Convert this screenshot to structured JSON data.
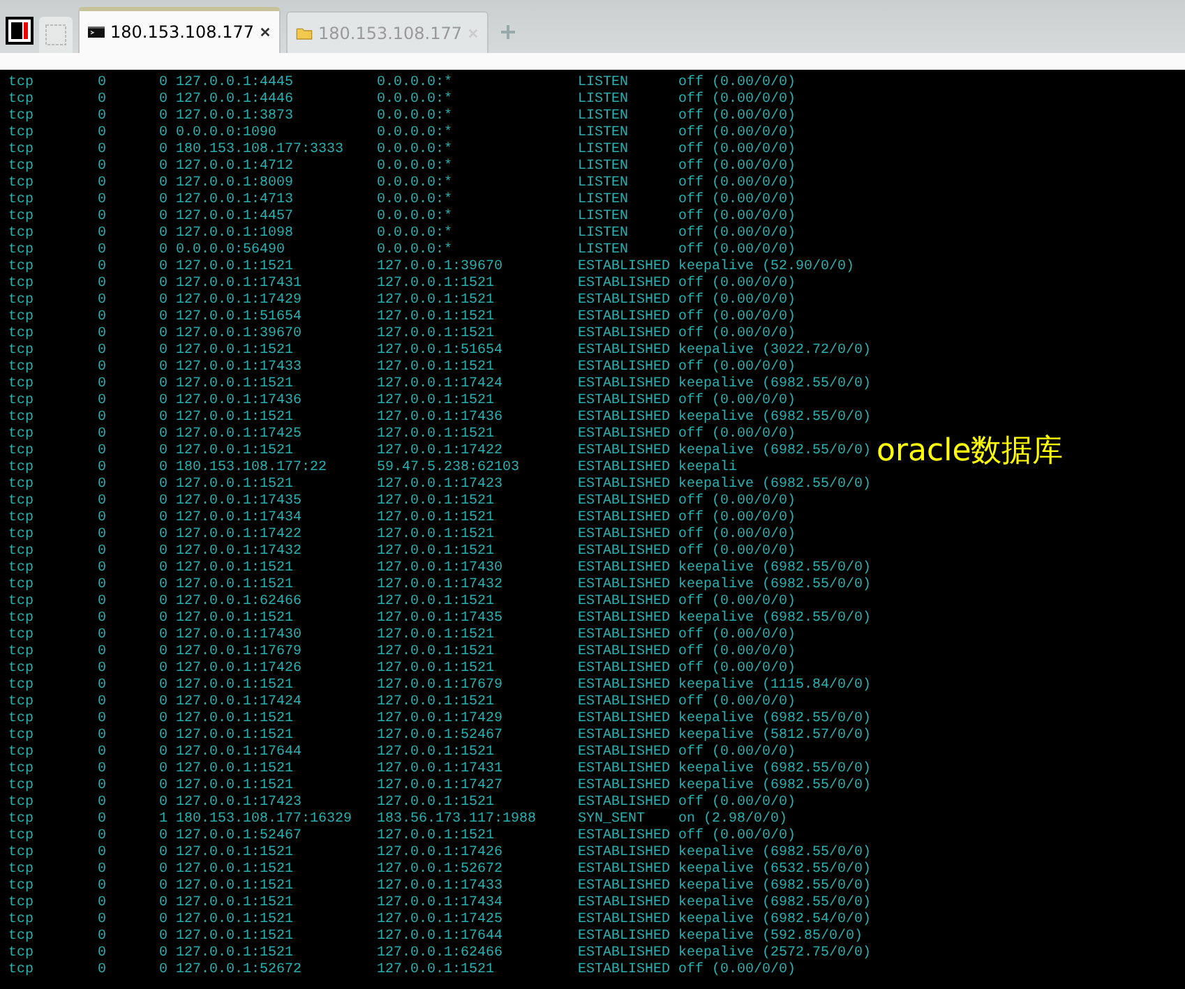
{
  "tabs": [
    {
      "kind": "terminal",
      "label": "180.153.108.177",
      "selected": true
    },
    {
      "kind": "folder",
      "label": "180.153.108.177",
      "selected": false
    }
  ],
  "terminal": {
    "rows": [
      {
        "proto": "tcp",
        "recv_q": "0",
        "send_q": "0",
        "local": "127.0.0.1:4445",
        "foreign": "0.0.0.0:*",
        "state": "LISTEN",
        "timer": "off (0.00/0/0)"
      },
      {
        "proto": "tcp",
        "recv_q": "0",
        "send_q": "0",
        "local": "127.0.0.1:4446",
        "foreign": "0.0.0.0:*",
        "state": "LISTEN",
        "timer": "off (0.00/0/0)"
      },
      {
        "proto": "tcp",
        "recv_q": "0",
        "send_q": "0",
        "local": "127.0.0.1:3873",
        "foreign": "0.0.0.0:*",
        "state": "LISTEN",
        "timer": "off (0.00/0/0)"
      },
      {
        "proto": "tcp",
        "recv_q": "0",
        "send_q": "0",
        "local": "0.0.0.0:1090",
        "foreign": "0.0.0.0:*",
        "state": "LISTEN",
        "timer": "off (0.00/0/0)"
      },
      {
        "proto": "tcp",
        "recv_q": "0",
        "send_q": "0",
        "local": "180.153.108.177:3333",
        "foreign": "0.0.0.0:*",
        "state": "LISTEN",
        "timer": "off (0.00/0/0)"
      },
      {
        "proto": "tcp",
        "recv_q": "0",
        "send_q": "0",
        "local": "127.0.0.1:4712",
        "foreign": "0.0.0.0:*",
        "state": "LISTEN",
        "timer": "off (0.00/0/0)"
      },
      {
        "proto": "tcp",
        "recv_q": "0",
        "send_q": "0",
        "local": "127.0.0.1:8009",
        "foreign": "0.0.0.0:*",
        "state": "LISTEN",
        "timer": "off (0.00/0/0)"
      },
      {
        "proto": "tcp",
        "recv_q": "0",
        "send_q": "0",
        "local": "127.0.0.1:4713",
        "foreign": "0.0.0.0:*",
        "state": "LISTEN",
        "timer": "off (0.00/0/0)"
      },
      {
        "proto": "tcp",
        "recv_q": "0",
        "send_q": "0",
        "local": "127.0.0.1:4457",
        "foreign": "0.0.0.0:*",
        "state": "LISTEN",
        "timer": "off (0.00/0/0)"
      },
      {
        "proto": "tcp",
        "recv_q": "0",
        "send_q": "0",
        "local": "127.0.0.1:1098",
        "foreign": "0.0.0.0:*",
        "state": "LISTEN",
        "timer": "off (0.00/0/0)"
      },
      {
        "proto": "tcp",
        "recv_q": "0",
        "send_q": "0",
        "local": "0.0.0.0:56490",
        "foreign": "0.0.0.0:*",
        "state": "LISTEN",
        "timer": "off (0.00/0/0)"
      },
      {
        "proto": "tcp",
        "recv_q": "0",
        "send_q": "0",
        "local": "127.0.0.1:1521",
        "foreign": "127.0.0.1:39670",
        "state": "ESTABLISHED",
        "timer": "keepalive (52.90/0/0)"
      },
      {
        "proto": "tcp",
        "recv_q": "0",
        "send_q": "0",
        "local": "127.0.0.1:17431",
        "foreign": "127.0.0.1:1521",
        "state": "ESTABLISHED",
        "timer": "off (0.00/0/0)"
      },
      {
        "proto": "tcp",
        "recv_q": "0",
        "send_q": "0",
        "local": "127.0.0.1:17429",
        "foreign": "127.0.0.1:1521",
        "state": "ESTABLISHED",
        "timer": "off (0.00/0/0)"
      },
      {
        "proto": "tcp",
        "recv_q": "0",
        "send_q": "0",
        "local": "127.0.0.1:51654",
        "foreign": "127.0.0.1:1521",
        "state": "ESTABLISHED",
        "timer": "off (0.00/0/0)"
      },
      {
        "proto": "tcp",
        "recv_q": "0",
        "send_q": "0",
        "local": "127.0.0.1:39670",
        "foreign": "127.0.0.1:1521",
        "state": "ESTABLISHED",
        "timer": "off (0.00/0/0)"
      },
      {
        "proto": "tcp",
        "recv_q": "0",
        "send_q": "0",
        "local": "127.0.0.1:1521",
        "foreign": "127.0.0.1:51654",
        "state": "ESTABLISHED",
        "timer": "keepalive (3022.72/0/0)"
      },
      {
        "proto": "tcp",
        "recv_q": "0",
        "send_q": "0",
        "local": "127.0.0.1:17433",
        "foreign": "127.0.0.1:1521",
        "state": "ESTABLISHED",
        "timer": "off (0.00/0/0)"
      },
      {
        "proto": "tcp",
        "recv_q": "0",
        "send_q": "0",
        "local": "127.0.0.1:1521",
        "foreign": "127.0.0.1:17424",
        "state": "ESTABLISHED",
        "timer": "keepalive (6982.55/0/0)"
      },
      {
        "proto": "tcp",
        "recv_q": "0",
        "send_q": "0",
        "local": "127.0.0.1:17436",
        "foreign": "127.0.0.1:1521",
        "state": "ESTABLISHED",
        "timer": "off (0.00/0/0)"
      },
      {
        "proto": "tcp",
        "recv_q": "0",
        "send_q": "0",
        "local": "127.0.0.1:1521",
        "foreign": "127.0.0.1:17436",
        "state": "ESTABLISHED",
        "timer": "keepalive (6982.55/0/0)"
      },
      {
        "proto": "tcp",
        "recv_q": "0",
        "send_q": "0",
        "local": "127.0.0.1:17425",
        "foreign": "127.0.0.1:1521",
        "state": "ESTABLISHED",
        "timer": "off (0.00/0/0)"
      },
      {
        "proto": "tcp",
        "recv_q": "0",
        "send_q": "0",
        "local": "127.0.0.1:1521",
        "foreign": "127.0.0.1:17422",
        "state": "ESTABLISHED",
        "timer": "keepalive (6982.55/0/0)"
      },
      {
        "proto": "tcp",
        "recv_q": "0",
        "send_q": "0",
        "local": "180.153.108.177:22",
        "foreign": "59.47.5.238:62103",
        "state": "ESTABLISHED",
        "timer": "keepali"
      },
      {
        "proto": "tcp",
        "recv_q": "0",
        "send_q": "0",
        "local": "127.0.0.1:1521",
        "foreign": "127.0.0.1:17423",
        "state": "ESTABLISHED",
        "timer": "keepalive (6982.55/0/0)"
      },
      {
        "proto": "tcp",
        "recv_q": "0",
        "send_q": "0",
        "local": "127.0.0.1:17435",
        "foreign": "127.0.0.1:1521",
        "state": "ESTABLISHED",
        "timer": "off (0.00/0/0)"
      },
      {
        "proto": "tcp",
        "recv_q": "0",
        "send_q": "0",
        "local": "127.0.0.1:17434",
        "foreign": "127.0.0.1:1521",
        "state": "ESTABLISHED",
        "timer": "off (0.00/0/0)"
      },
      {
        "proto": "tcp",
        "recv_q": "0",
        "send_q": "0",
        "local": "127.0.0.1:17422",
        "foreign": "127.0.0.1:1521",
        "state": "ESTABLISHED",
        "timer": "off (0.00/0/0)"
      },
      {
        "proto": "tcp",
        "recv_q": "0",
        "send_q": "0",
        "local": "127.0.0.1:17432",
        "foreign": "127.0.0.1:1521",
        "state": "ESTABLISHED",
        "timer": "off (0.00/0/0)"
      },
      {
        "proto": "tcp",
        "recv_q": "0",
        "send_q": "0",
        "local": "127.0.0.1:1521",
        "foreign": "127.0.0.1:17430",
        "state": "ESTABLISHED",
        "timer": "keepalive (6982.55/0/0)"
      },
      {
        "proto": "tcp",
        "recv_q": "0",
        "send_q": "0",
        "local": "127.0.0.1:1521",
        "foreign": "127.0.0.1:17432",
        "state": "ESTABLISHED",
        "timer": "keepalive (6982.55/0/0)"
      },
      {
        "proto": "tcp",
        "recv_q": "0",
        "send_q": "0",
        "local": "127.0.0.1:62466",
        "foreign": "127.0.0.1:1521",
        "state": "ESTABLISHED",
        "timer": "off (0.00/0/0)"
      },
      {
        "proto": "tcp",
        "recv_q": "0",
        "send_q": "0",
        "local": "127.0.0.1:1521",
        "foreign": "127.0.0.1:17435",
        "state": "ESTABLISHED",
        "timer": "keepalive (6982.55/0/0)"
      },
      {
        "proto": "tcp",
        "recv_q": "0",
        "send_q": "0",
        "local": "127.0.0.1:17430",
        "foreign": "127.0.0.1:1521",
        "state": "ESTABLISHED",
        "timer": "off (0.00/0/0)"
      },
      {
        "proto": "tcp",
        "recv_q": "0",
        "send_q": "0",
        "local": "127.0.0.1:17679",
        "foreign": "127.0.0.1:1521",
        "state": "ESTABLISHED",
        "timer": "off (0.00/0/0)"
      },
      {
        "proto": "tcp",
        "recv_q": "0",
        "send_q": "0",
        "local": "127.0.0.1:17426",
        "foreign": "127.0.0.1:1521",
        "state": "ESTABLISHED",
        "timer": "off (0.00/0/0)"
      },
      {
        "proto": "tcp",
        "recv_q": "0",
        "send_q": "0",
        "local": "127.0.0.1:1521",
        "foreign": "127.0.0.1:17679",
        "state": "ESTABLISHED",
        "timer": "keepalive (1115.84/0/0)"
      },
      {
        "proto": "tcp",
        "recv_q": "0",
        "send_q": "0",
        "local": "127.0.0.1:17424",
        "foreign": "127.0.0.1:1521",
        "state": "ESTABLISHED",
        "timer": "off (0.00/0/0)"
      },
      {
        "proto": "tcp",
        "recv_q": "0",
        "send_q": "0",
        "local": "127.0.0.1:1521",
        "foreign": "127.0.0.1:17429",
        "state": "ESTABLISHED",
        "timer": "keepalive (6982.55/0/0)"
      },
      {
        "proto": "tcp",
        "recv_q": "0",
        "send_q": "0",
        "local": "127.0.0.1:1521",
        "foreign": "127.0.0.1:52467",
        "state": "ESTABLISHED",
        "timer": "keepalive (5812.57/0/0)"
      },
      {
        "proto": "tcp",
        "recv_q": "0",
        "send_q": "0",
        "local": "127.0.0.1:17644",
        "foreign": "127.0.0.1:1521",
        "state": "ESTABLISHED",
        "timer": "off (0.00/0/0)"
      },
      {
        "proto": "tcp",
        "recv_q": "0",
        "send_q": "0",
        "local": "127.0.0.1:1521",
        "foreign": "127.0.0.1:17431",
        "state": "ESTABLISHED",
        "timer": "keepalive (6982.55/0/0)"
      },
      {
        "proto": "tcp",
        "recv_q": "0",
        "send_q": "0",
        "local": "127.0.0.1:1521",
        "foreign": "127.0.0.1:17427",
        "state": "ESTABLISHED",
        "timer": "keepalive (6982.55/0/0)"
      },
      {
        "proto": "tcp",
        "recv_q": "0",
        "send_q": "0",
        "local": "127.0.0.1:17423",
        "foreign": "127.0.0.1:1521",
        "state": "ESTABLISHED",
        "timer": "off (0.00/0/0)"
      },
      {
        "proto": "tcp",
        "recv_q": "0",
        "send_q": "1",
        "local": "180.153.108.177:16329",
        "foreign": "183.56.173.117:1988",
        "state": "SYN_SENT",
        "timer": "on (2.98/0/0)"
      },
      {
        "proto": "tcp",
        "recv_q": "0",
        "send_q": "0",
        "local": "127.0.0.1:52467",
        "foreign": "127.0.0.1:1521",
        "state": "ESTABLISHED",
        "timer": "off (0.00/0/0)"
      },
      {
        "proto": "tcp",
        "recv_q": "0",
        "send_q": "0",
        "local": "127.0.0.1:1521",
        "foreign": "127.0.0.1:17426",
        "state": "ESTABLISHED",
        "timer": "keepalive (6982.55/0/0)"
      },
      {
        "proto": "tcp",
        "recv_q": "0",
        "send_q": "0",
        "local": "127.0.0.1:1521",
        "foreign": "127.0.0.1:52672",
        "state": "ESTABLISHED",
        "timer": "keepalive (6532.55/0/0)"
      },
      {
        "proto": "tcp",
        "recv_q": "0",
        "send_q": "0",
        "local": "127.0.0.1:1521",
        "foreign": "127.0.0.1:17433",
        "state": "ESTABLISHED",
        "timer": "keepalive (6982.55/0/0)"
      },
      {
        "proto": "tcp",
        "recv_q": "0",
        "send_q": "0",
        "local": "127.0.0.1:1521",
        "foreign": "127.0.0.1:17434",
        "state": "ESTABLISHED",
        "timer": "keepalive (6982.55/0/0)"
      },
      {
        "proto": "tcp",
        "recv_q": "0",
        "send_q": "0",
        "local": "127.0.0.1:1521",
        "foreign": "127.0.0.1:17425",
        "state": "ESTABLISHED",
        "timer": "keepalive (6982.54/0/0)"
      },
      {
        "proto": "tcp",
        "recv_q": "0",
        "send_q": "0",
        "local": "127.0.0.1:1521",
        "foreign": "127.0.0.1:17644",
        "state": "ESTABLISHED",
        "timer": "keepalive (592.85/0/0)"
      },
      {
        "proto": "tcp",
        "recv_q": "0",
        "send_q": "0",
        "local": "127.0.0.1:1521",
        "foreign": "127.0.0.1:62466",
        "state": "ESTABLISHED",
        "timer": "keepalive (2572.75/0/0)"
      },
      {
        "proto": "tcp",
        "recv_q": "0",
        "send_q": "0",
        "local": "127.0.0.1:52672",
        "foreign": "127.0.0.1:1521",
        "state": "ESTABLISHED",
        "timer": "off (0.00/0/0)"
      }
    ],
    "annotation": "oracle数据库"
  }
}
